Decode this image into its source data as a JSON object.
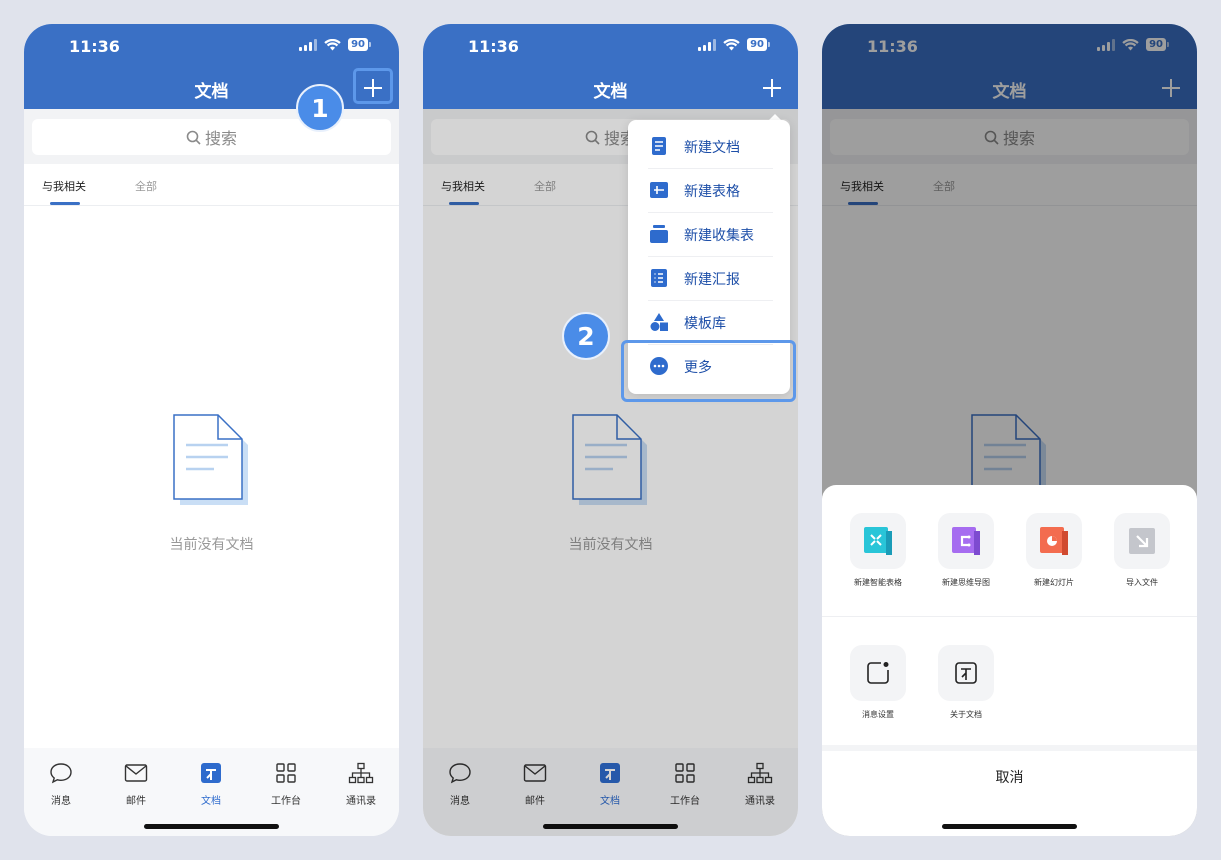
{
  "status": {
    "time": "11:36",
    "battery": "90"
  },
  "header": {
    "title": "文档"
  },
  "search": {
    "placeholder": "搜索"
  },
  "tabs": [
    {
      "label": "与我相关"
    },
    {
      "label": "全部"
    }
  ],
  "empty": {
    "message": "当前没有文档"
  },
  "nav": {
    "items": [
      {
        "label": "消息",
        "icon": "chat-bubble-icon"
      },
      {
        "label": "邮件",
        "icon": "mail-icon"
      },
      {
        "label": "文档",
        "icon": "docs-icon"
      },
      {
        "label": "工作台",
        "icon": "grid-icon"
      },
      {
        "label": "通讯录",
        "icon": "org-chart-icon"
      }
    ]
  },
  "steps": {
    "one": "1",
    "two": "2"
  },
  "menu": {
    "items": [
      {
        "label": "新建文档",
        "icon": "doc-icon"
      },
      {
        "label": "新建表格",
        "icon": "table-icon"
      },
      {
        "label": "新建收集表",
        "icon": "form-icon"
      },
      {
        "label": "新建汇报",
        "icon": "report-icon"
      },
      {
        "label": "模板库",
        "icon": "shapes-icon"
      },
      {
        "label": "更多",
        "icon": "more-icon"
      }
    ]
  },
  "sheet": {
    "row1": [
      {
        "label": "新建智能表格",
        "icon": "smart-table-icon"
      },
      {
        "label": "新建思维导图",
        "icon": "mindmap-icon"
      },
      {
        "label": "新建幻灯片",
        "icon": "slides-icon"
      },
      {
        "label": "导入文件",
        "icon": "import-icon"
      }
    ],
    "row2": [
      {
        "label": "消息设置",
        "icon": "notification-settings-icon"
      },
      {
        "label": "关于文档",
        "icon": "about-docs-icon"
      }
    ],
    "cancel": "取消"
  },
  "colors": {
    "header": "#3a70c5",
    "accent": "#2e6bcd",
    "highlight": "#5d98ea"
  }
}
